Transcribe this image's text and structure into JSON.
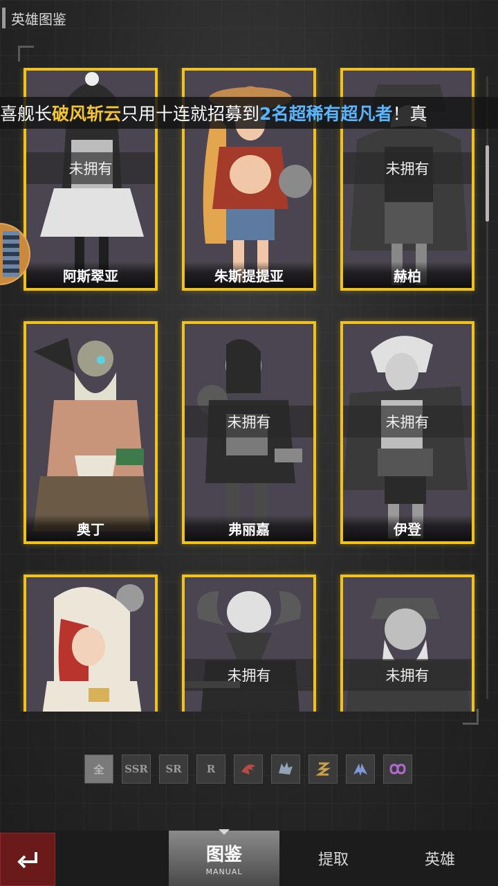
{
  "page": {
    "title": "英雄图鉴"
  },
  "ticker": {
    "prefix": "喜舰长",
    "player": "破风斩云",
    "middle": "只用十连就招募到",
    "reward": "2名超稀有超凡者",
    "suffix": "！真"
  },
  "heroes": [
    {
      "name": "阿斯翠亚",
      "status": "未拥有",
      "owned": false,
      "show_name": true
    },
    {
      "name": "朱斯提提亚",
      "status": "",
      "owned": true,
      "show_name": true
    },
    {
      "name": "赫柏",
      "status": "未拥有",
      "owned": false,
      "show_name": true
    },
    {
      "name": "奥丁",
      "status": "",
      "owned": true,
      "show_name": true
    },
    {
      "name": "弗丽嘉",
      "status": "未拥有",
      "owned": false,
      "show_name": true
    },
    {
      "name": "伊登",
      "status": "未拥有",
      "owned": false,
      "show_name": true
    },
    {
      "name": "",
      "status": "",
      "owned": true,
      "show_name": false
    },
    {
      "name": "",
      "status": "未拥有",
      "owned": false,
      "show_name": false
    },
    {
      "name": "",
      "status": "未拥有",
      "owned": false,
      "show_name": false
    }
  ],
  "filters": [
    {
      "label": "全",
      "active": true
    },
    {
      "label": "SSR",
      "active": false
    },
    {
      "label": "SR",
      "active": false
    },
    {
      "label": "R",
      "active": false
    },
    {
      "icon": "claw-faction-icon",
      "active": false
    },
    {
      "icon": "wolf-faction-icon",
      "active": false
    },
    {
      "icon": "serpent-faction-icon",
      "active": false
    },
    {
      "icon": "wings-faction-icon",
      "active": false
    },
    {
      "icon": "infinity-faction-icon",
      "active": false
    }
  ],
  "nav": {
    "back_icon": "return-icon",
    "manual_label": "图鉴",
    "manual_sub": "MANUAL",
    "extract_label": "提取",
    "heroes_label": "英雄"
  },
  "colors": {
    "card_border": "#f0c21c",
    "ticker_gold": "#f3c531",
    "ticker_blue": "#58b6ff",
    "back_button": "#6b1a1a"
  }
}
